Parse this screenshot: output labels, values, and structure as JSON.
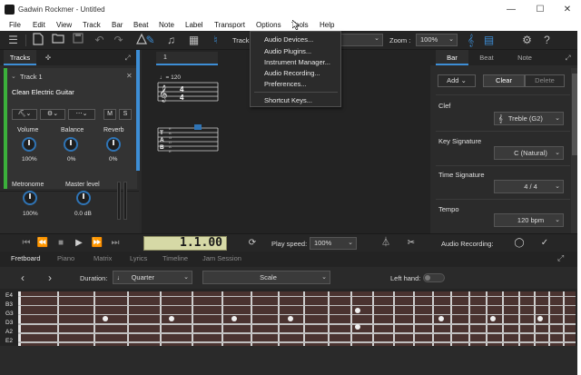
{
  "window": {
    "title": "Gadwin Rockmer - Untitled",
    "controls": [
      "—",
      "☐",
      "✕"
    ]
  },
  "menubar": {
    "items": [
      "File",
      "Edit",
      "View",
      "Track",
      "Bar",
      "Beat",
      "Note",
      "Label",
      "Transport",
      "Options",
      "Tools",
      "Help"
    ]
  },
  "toolbar": {
    "track_label": "Track",
    "zoom_label": "Zoom :",
    "zoom_value": "100%"
  },
  "tools_menu": {
    "items": [
      "Audio Devices...",
      "Audio Plugins...",
      "Instrument Manager...",
      "Audio Recording...",
      "Preferences...",
      "Shortcut Keys..."
    ]
  },
  "tracks_panel": {
    "tab_tracks": "Tracks",
    "track_name": "Track 1",
    "instrument": "Clean Electric Guitar",
    "mute": "M",
    "solo": "S",
    "volume_label": "Volume",
    "volume_value": "100%",
    "balance_label": "Balance",
    "balance_value": "0%",
    "reverb_label": "Reverb",
    "reverb_value": "0%",
    "metronome_label": "Metronome",
    "metronome_value": "100%",
    "master_label": "Master level",
    "master_value": "0.0 dB"
  },
  "score": {
    "bar_number": "1",
    "tempo_mark": "♩= 120",
    "time_sig_top": "4",
    "time_sig_bottom": "4",
    "tab_letters": [
      "T",
      "A",
      "B"
    ],
    "string_letters": [
      "E",
      "B",
      "G",
      "D",
      "A",
      "E"
    ]
  },
  "right_panel": {
    "tabs": [
      "Bar",
      "Beat",
      "Note"
    ],
    "add_label": "Add",
    "clear_label": "Clear",
    "delete_label": "Delete",
    "clef_label": "Clef",
    "clef_value": "Treble (G2)",
    "key_label": "Key Signature",
    "key_value": "C (Natural)",
    "time_label": "Time Signature",
    "time_value": "4 / 4",
    "tempo_label": "Tempo",
    "tempo_value": "120 bpm"
  },
  "transport": {
    "time_display": "1.1.00",
    "play_speed_label": "Play speed:",
    "play_speed_value": "100%",
    "audio_recording_label": "Audio Recording:"
  },
  "bottom_tabs": {
    "items": [
      "Fretboard",
      "Piano",
      "Matrix",
      "Lyrics",
      "Timeline",
      "Jam Session"
    ]
  },
  "fretboard_toolbar": {
    "duration_label": "Duration:",
    "duration_value": "Quarter",
    "scale_value": "Scale",
    "left_hand_label": "Left hand:"
  },
  "fretboard": {
    "strings": [
      "E4",
      "B3",
      "G3",
      "D3",
      "A2",
      "E2"
    ]
  },
  "colors": {
    "accent_blue": "#3d8ed6",
    "track_green": "#3bb03b",
    "lcd_bg": "#d6d9a6",
    "fretboard_wood": "#4a3330"
  }
}
